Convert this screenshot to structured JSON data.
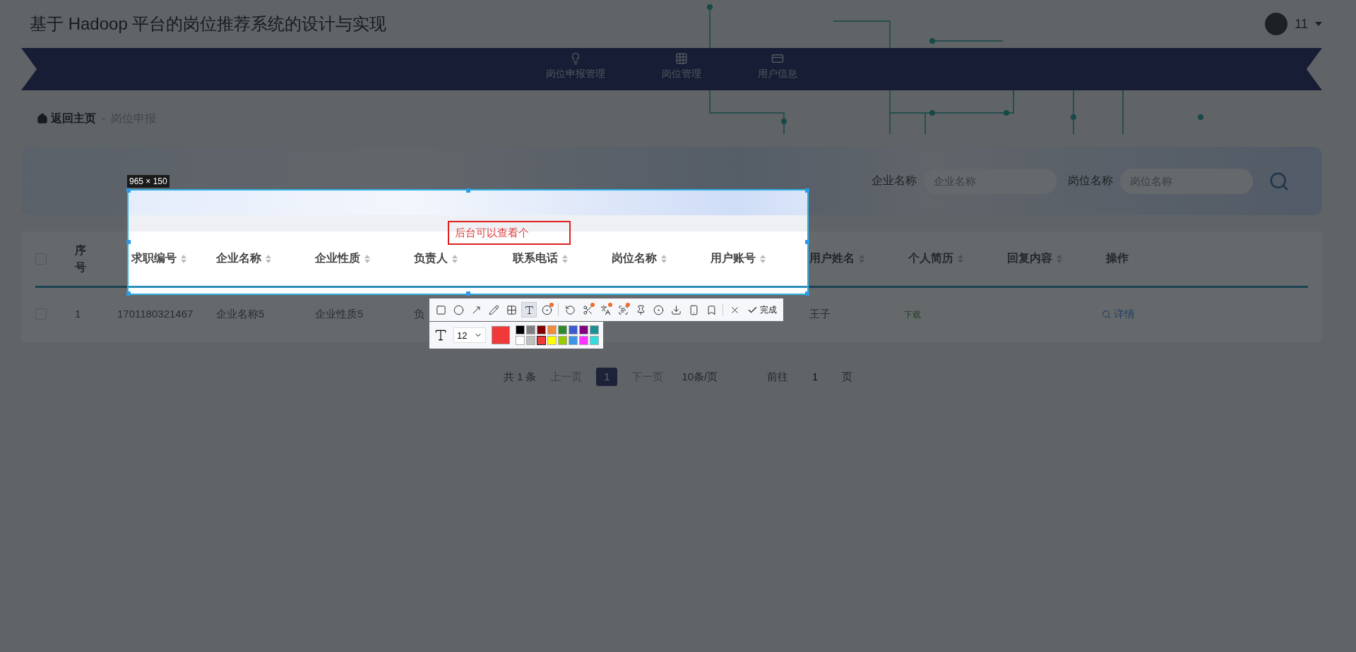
{
  "header": {
    "title": "基于 Hadoop 平台的岗位推荐系统的设计与实现",
    "user": {
      "name": "11"
    }
  },
  "nav": {
    "items": [
      {
        "label": "岗位申报管理",
        "kind": "bulb",
        "selected": false
      },
      {
        "label": "岗位管理",
        "kind": "grid",
        "selected": false
      },
      {
        "label": "用户信息",
        "kind": "card",
        "selected": false
      }
    ]
  },
  "breadcrumb": {
    "home": "返回主页",
    "separator": "-",
    "current": "岗位申报"
  },
  "search": {
    "fields": [
      {
        "label": "企业名称",
        "placeholder": "企业名称"
      },
      {
        "label": "岗位名称",
        "placeholder": "岗位名称"
      }
    ]
  },
  "table": {
    "select_all_checked": false,
    "columns": [
      {
        "label": "序号",
        "sortable": false
      },
      {
        "label": "求职编号",
        "sortable": true
      },
      {
        "label": "企业名称",
        "sortable": true
      },
      {
        "label": "企业性质",
        "sortable": true
      },
      {
        "label": "负责人",
        "sortable": true
      },
      {
        "label": "联系电话",
        "sortable": true
      },
      {
        "label": "岗位名称",
        "sortable": true
      },
      {
        "label": "用户账号",
        "sortable": true
      },
      {
        "label": "用户姓名",
        "sortable": true
      },
      {
        "label": "个人简历",
        "sortable": true
      },
      {
        "label": "回复内容",
        "sortable": true
      },
      {
        "label": "操作",
        "sortable": false
      }
    ],
    "rows": [
      {
        "checked": false,
        "index": "1",
        "job_no": "1701180321467",
        "company": "企业名称5",
        "nature": "企业性质5",
        "contact_person": "负",
        "user_name": "王子",
        "resume": "下载",
        "action": "详情"
      }
    ]
  },
  "pagination": {
    "total": "共 1 条",
    "prev": "上一页",
    "pages": [
      {
        "label": "1",
        "selected": true
      }
    ],
    "next": "下一页",
    "page_size": "10条/页",
    "goto": "前往",
    "goto_value": "1",
    "goto_suffix": "页"
  },
  "capture": {
    "size": "965 × 150",
    "annotation": "后台可以查看个",
    "tools": [
      {
        "kind": "rect",
        "selected": false,
        "badge": false
      },
      {
        "kind": "circle",
        "selected": false,
        "badge": false
      },
      {
        "kind": "arrow",
        "selected": false,
        "badge": false
      },
      {
        "kind": "pencil",
        "selected": false,
        "badge": false
      },
      {
        "kind": "mosaic",
        "selected": false,
        "badge": false
      },
      {
        "kind": "text",
        "selected": true,
        "badge": false
      },
      {
        "kind": "number",
        "selected": false,
        "badge": true
      },
      {
        "kind": "separator"
      },
      {
        "kind": "undo",
        "selected": false,
        "badge": false
      },
      {
        "kind": "scissors",
        "selected": false,
        "badge": true
      },
      {
        "kind": "translate",
        "selected": false,
        "badge": true
      },
      {
        "kind": "ocr",
        "selected": false,
        "badge": true
      },
      {
        "kind": "pin",
        "selected": false,
        "badge": false
      },
      {
        "kind": "record",
        "selected": false,
        "badge": false
      },
      {
        "kind": "download",
        "selected": false,
        "badge": false
      },
      {
        "kind": "phone",
        "selected": false,
        "badge": false
      },
      {
        "kind": "bookmark",
        "selected": false,
        "badge": false
      },
      {
        "kind": "separator"
      },
      {
        "kind": "close",
        "selected": false,
        "badge": false
      }
    ],
    "done": "完成",
    "font_size": "12",
    "palette": [
      {
        "color": "#000000",
        "selected": false
      },
      {
        "color": "#808080",
        "selected": false
      },
      {
        "color": "#800000",
        "selected": false
      },
      {
        "color": "#f08c3c",
        "selected": false
      },
      {
        "color": "#2f8a2f",
        "selected": false
      },
      {
        "color": "#3c5ad2",
        "selected": false
      },
      {
        "color": "#800080",
        "selected": false
      },
      {
        "color": "#1a9090",
        "selected": false
      },
      {
        "color": "#ffffff",
        "selected": false
      },
      {
        "color": "#c0c0c0",
        "selected": false
      },
      {
        "color": "#f03a3a",
        "selected": true
      },
      {
        "color": "#ffff00",
        "selected": false
      },
      {
        "color": "#99cc00",
        "selected": false
      },
      {
        "color": "#3c96e6",
        "selected": false
      },
      {
        "color": "#ff33ff",
        "selected": false
      },
      {
        "color": "#33dddd",
        "selected": false
      }
    ]
  }
}
